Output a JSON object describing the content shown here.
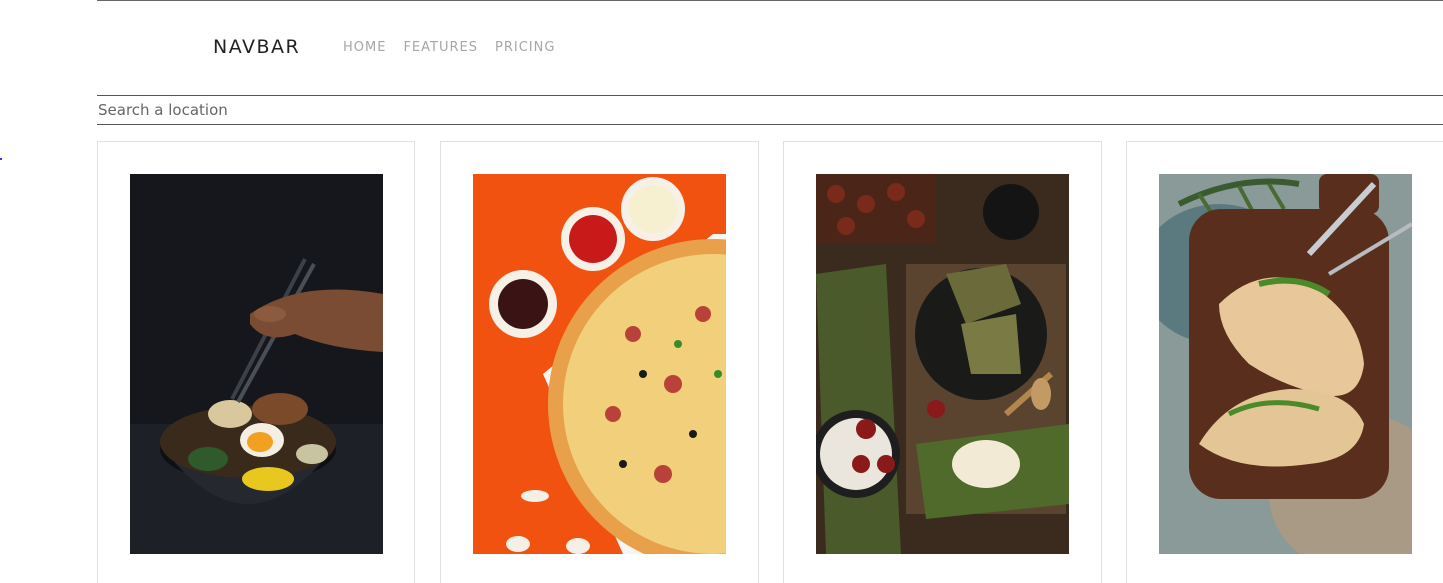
{
  "navbar": {
    "brand": "NAVBAR",
    "links": [
      {
        "label": "HOME"
      },
      {
        "label": "FEATURES"
      },
      {
        "label": "PRICING"
      }
    ]
  },
  "search": {
    "placeholder": "Search a location",
    "value": ""
  },
  "cards": [
    {
      "icon": "ramen-photo"
    },
    {
      "icon": "pizza-photo"
    },
    {
      "icon": "zongzi-photo"
    },
    {
      "icon": "sandwich-photo"
    }
  ],
  "colors": {
    "nav_link": "#a6a6a6",
    "brand": "#222222",
    "border": "#555555",
    "card_border": "#e0e0e0"
  }
}
